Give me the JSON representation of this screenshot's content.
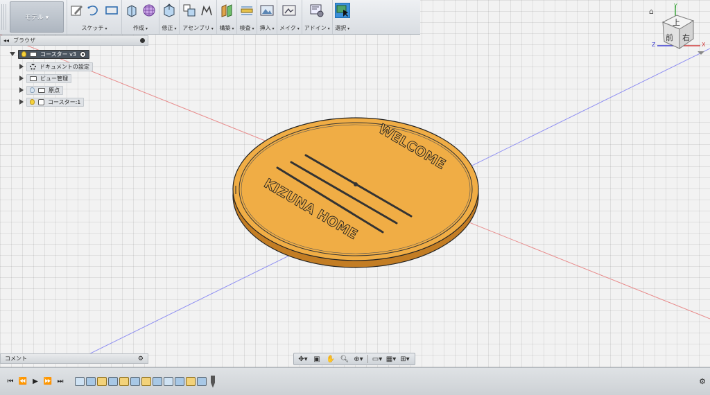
{
  "workspace": {
    "label": "モデル ▾"
  },
  "toolbar": {
    "groups": [
      {
        "label": "スケッチ"
      },
      {
        "label": "作成"
      },
      {
        "label": "修正"
      },
      {
        "label": "アセンブリ"
      },
      {
        "label": "構築"
      },
      {
        "label": "検査"
      },
      {
        "label": "挿入"
      },
      {
        "label": "メイク"
      },
      {
        "label": "アドイン"
      },
      {
        "label": "選択"
      }
    ]
  },
  "browser": {
    "title": "ブラウザ",
    "root": "コースター v3",
    "items": [
      {
        "label": "ドキュメントの設定"
      },
      {
        "label": "ビュー管理"
      },
      {
        "label": "原点"
      },
      {
        "label": "コースター:1"
      }
    ]
  },
  "comments": {
    "label": "コメント"
  },
  "viewcube": {
    "top": "上",
    "front": "前",
    "right": "右",
    "axis_x": "X",
    "axis_y": "Y",
    "axis_z": "Z"
  },
  "model": {
    "text_top": "WELCOME",
    "text_bottom": "KIZUNA HOME",
    "color": "#f0ad45"
  },
  "colors": {
    "accent": "#3b8fd8",
    "axis_red": "#e06060",
    "axis_blue": "#6a6ae6"
  }
}
